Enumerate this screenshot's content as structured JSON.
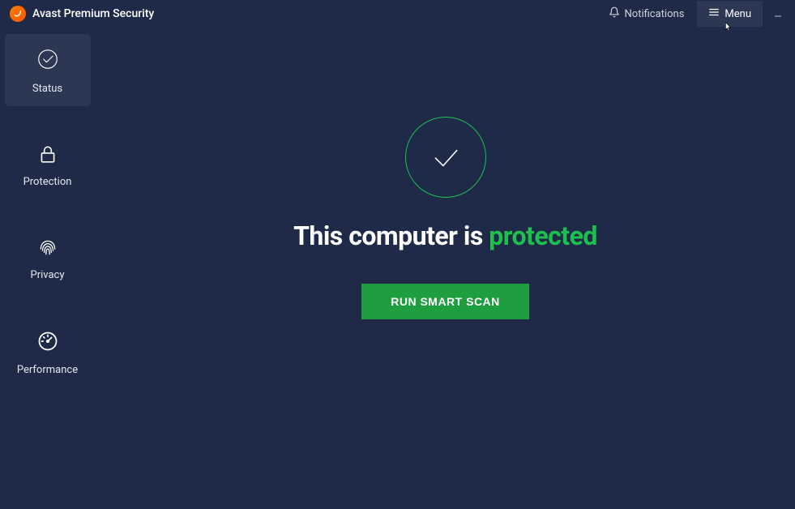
{
  "app_title": "Avast Premium Security",
  "titlebar": {
    "notifications_label": "Notifications",
    "menu_label": "Menu"
  },
  "sidebar": {
    "items": [
      {
        "label": "Status",
        "active": true
      },
      {
        "label": "Protection",
        "active": false
      },
      {
        "label": "Privacy",
        "active": false
      },
      {
        "label": "Performance",
        "active": false
      }
    ]
  },
  "main": {
    "status_prefix": "This computer is ",
    "status_word": "protected",
    "scan_button": "RUN SMART SCAN"
  },
  "colors": {
    "brand": "#ff7a00",
    "accent_green": "#1fbf4f",
    "button_green": "#1e9e3e",
    "bg": "#1e2a47"
  }
}
